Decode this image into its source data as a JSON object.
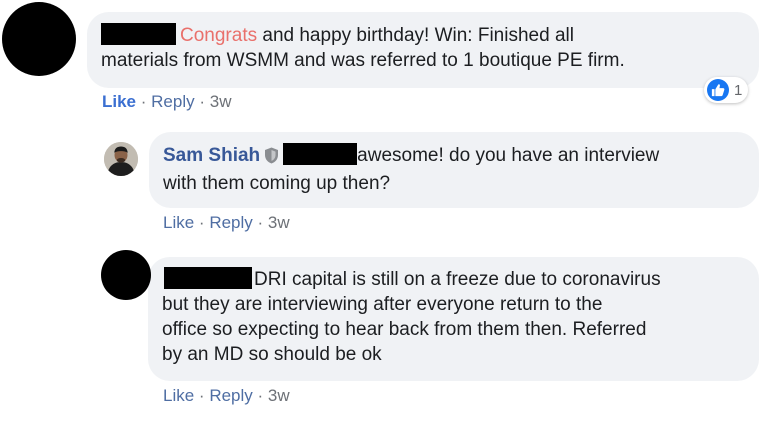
{
  "colors": {
    "bubble_bg": "#f0f2f5",
    "author": "#385898",
    "action_primary": "#3b6fd1",
    "action_link": "#4f6ea3",
    "accent": "#e9706b",
    "meta": "#6d7177",
    "reaction_blue": "#1877f2"
  },
  "comments": [
    {
      "author": "",
      "author_redacted": true,
      "text_line1_accent": "Congrats",
      "text_line1_rest": " and happy birthday! Win: Finished all",
      "text_line2": "materials from WSMM and was referred to 1 boutique PE firm.",
      "actions": {
        "like": "Like",
        "reply": "Reply",
        "age": "3w",
        "separator": "·"
      },
      "reaction": {
        "icon": "thumbs-up-icon",
        "count": "1"
      }
    },
    {
      "author": "Sam Shiah",
      "badge_icon": "shield-icon",
      "mention_redacted": true,
      "text_line1": "awesome! do you have an interview",
      "text_line2": "with them coming up then?",
      "actions": {
        "like": "Like",
        "reply": "Reply",
        "age": "3w",
        "separator": "·"
      }
    },
    {
      "author": "",
      "author_redacted": true,
      "text_line1": "DRI capital is still on a freeze due to coronavirus",
      "text_line2": "but they are interviewing after everyone return to the",
      "text_line3": "office so expecting to hear back from them then. Referred",
      "text_line4": "by an MD so should be ok",
      "actions": {
        "like": "Like",
        "reply": "Reply",
        "age": "3w",
        "separator": "·"
      }
    }
  ]
}
